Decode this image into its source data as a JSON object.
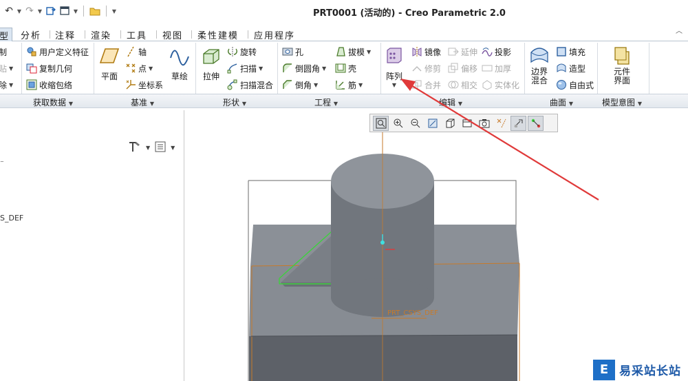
{
  "window": {
    "title": "PRT0001 (活动的) - Creo Parametric 2.0"
  },
  "tabs": [
    {
      "label": "型",
      "active": true
    },
    {
      "label": "分析"
    },
    {
      "label": "注释"
    },
    {
      "label": "渲染"
    },
    {
      "label": "工具"
    },
    {
      "label": "视图"
    },
    {
      "label": "柔性建模"
    },
    {
      "label": "应用程序"
    }
  ],
  "ribbon": {
    "operations": {
      "copy": "制",
      "paste": "贴",
      "delete": "除"
    },
    "get_data": {
      "user_feature": "用户定义特征",
      "copy_geometry": "复制几何",
      "shrinkwrap": "收缩包络",
      "group_label": "获取数据"
    },
    "datum": {
      "plane": "平面",
      "axis": "轴",
      "point": "点",
      "csys": "坐标系",
      "sketch": "草绘",
      "group_label": "基准"
    },
    "shapes": {
      "extrude": "拉伸",
      "revolve": "旋转",
      "sweep": "扫描",
      "swept_blend": "扫描混合",
      "group_label": "形状"
    },
    "engineering": {
      "hole": "孔",
      "round": "倒圆角",
      "chamfer": "倒角",
      "draft": "拔模",
      "shell": "壳",
      "rib": "筋",
      "group_label": "工程"
    },
    "editing": {
      "pattern": "阵列",
      "mirror": "镜像",
      "extend": "延伸",
      "project": "投影",
      "trim": "修剪",
      "offset": "偏移",
      "thicken": "加厚",
      "merge": "合并",
      "intersect": "相交",
      "solidify": "实体化",
      "group_label": "编辑"
    },
    "surfaces": {
      "boundary_blend": "边界\n混合",
      "fill": "填充",
      "style": "造型",
      "freestyle": "自由式",
      "group_label": "曲面"
    },
    "model_intent": {
      "component_interface": "元件\n界面",
      "group_label": "模型意图"
    }
  },
  "tree": {
    "csys_label": "S_DEF"
  },
  "graphics": {
    "csys_label": "PRT_CSYS_DEF"
  },
  "watermark": {
    "logo": "E",
    "text": "易采站长站"
  },
  "colors": {
    "arrow": "#e03a3a",
    "part_body": "#8b9097",
    "part_dark": "#5d6168",
    "feature_edge": "#3dd13d",
    "datum_orange": "#c77a2a"
  }
}
